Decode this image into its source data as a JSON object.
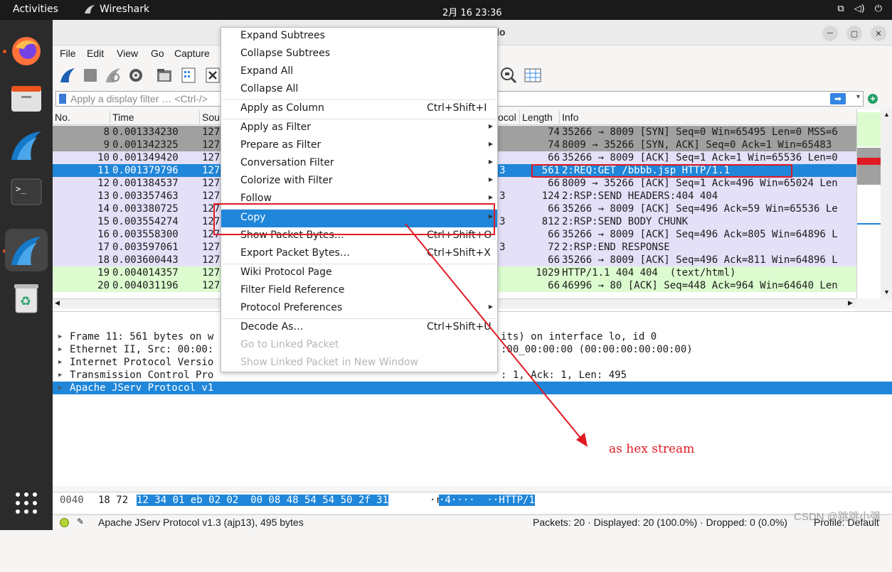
{
  "topbar": {
    "activities": "Activities",
    "app_name": "Wireshark",
    "clock": "2月 16  23:36"
  },
  "window": {
    "title_suffix": "lo",
    "menu": [
      "File",
      "Edit",
      "View",
      "Go",
      "Capture"
    ],
    "filter_placeholder": "Apply a display filter … <Ctrl-/>"
  },
  "packet_list": {
    "columns": [
      "No.",
      "Time",
      "Sou",
      "ocol",
      "Length",
      "Info"
    ],
    "rows": [
      {
        "no": "8",
        "time": "0.001334230",
        "src": "127",
        "proto": "",
        "len": "74",
        "info": "35266 → 8009 [SYN] Seq=0 Win=65495 Len=0 MSS=6",
        "style": "gray"
      },
      {
        "no": "9",
        "time": "0.001342325",
        "src": "127",
        "proto": "",
        "len": "74",
        "info": "8009 → 35266 [SYN, ACK] Seq=0 Ack=1 Win=65483",
        "style": "gray"
      },
      {
        "no": "10",
        "time": "0.001349420",
        "src": "127",
        "proto": "",
        "len": "66",
        "info": "35266 → 8009 [ACK] Seq=1 Ack=1 Win=65536 Len=0",
        "style": "lav"
      },
      {
        "no": "11",
        "time": "0.001379796",
        "src": "127",
        "proto": "3",
        "len": "561",
        "info": "2:REQ:GET /bbbb.jsp HTTP/1.1",
        "style": "sel"
      },
      {
        "no": "12",
        "time": "0.001384537",
        "src": "127",
        "proto": "",
        "len": "66",
        "info": "8009 → 35266 [ACK] Seq=1 Ack=496 Win=65024 Len",
        "style": "lav"
      },
      {
        "no": "13",
        "time": "0.003357463",
        "src": "127",
        "proto": "3",
        "len": "124",
        "info": "2:RSP:SEND HEADERS:404 404",
        "style": "lav"
      },
      {
        "no": "14",
        "time": "0.003380725",
        "src": "127",
        "proto": "",
        "len": "66",
        "info": "35266 → 8009 [ACK] Seq=496 Ack=59 Win=65536 Le",
        "style": "lav"
      },
      {
        "no": "15",
        "time": "0.003554274",
        "src": "127",
        "proto": "3",
        "len": "812",
        "info": "2:RSP:SEND BODY CHUNK",
        "style": "lav"
      },
      {
        "no": "16",
        "time": "0.003558300",
        "src": "127",
        "proto": "",
        "len": "66",
        "info": "35266 → 8009 [ACK] Seq=496 Ack=805 Win=64896 L",
        "style": "lav"
      },
      {
        "no": "17",
        "time": "0.003597061",
        "src": "127",
        "proto": "3",
        "len": "72",
        "info": "2:RSP:END RESPONSE",
        "style": "lav"
      },
      {
        "no": "18",
        "time": "0.003600443",
        "src": "127",
        "proto": "",
        "len": "66",
        "info": "35266 → 8009 [ACK] Seq=496 Ack=811 Win=64896 L",
        "style": "lav"
      },
      {
        "no": "19",
        "time": "0.004014357",
        "src": "127",
        "proto": "",
        "len": "1029",
        "info": "HTTP/1.1 404 404  (text/html)",
        "style": "green"
      },
      {
        "no": "20",
        "time": "0.004031196",
        "src": "127",
        "proto": "",
        "len": "66",
        "info": "46996 → 80 [ACK] Seq=448 Ack=964 Win=64640 Len",
        "style": "green"
      }
    ]
  },
  "details": {
    "rows": [
      {
        "left": "Frame 11: 561 bytes on w",
        "right": "its) on interface lo, id 0"
      },
      {
        "left": "Ethernet II, Src: 00:00:",
        "right": ":00_00:00:00 (00:00:00:00:00:00)"
      },
      {
        "left": "Internet Protocol Versio",
        "right": ""
      },
      {
        "left": "Transmission Control Pro",
        "right": ": 1, Ack: 1, Len: 495"
      },
      {
        "left": "Apache JServ Protocol v1",
        "right": ""
      }
    ]
  },
  "bytes": {
    "offset": "0040",
    "hex_plain": "18 72",
    "hex_hl": "12 34 01 eb 02 02  00 08 48 54 54 50 2f 31",
    "ascii_plain": "·r",
    "ascii_hl": "·4····  ··HTTP/1"
  },
  "status": {
    "protocol": "Apache JServ Protocol v1.3 (ajp13), 495 bytes",
    "packets": "Packets: 20 · Displayed: 20 (100.0%) · Dropped: 0 (0.0%)",
    "profile": "Profile: Default"
  },
  "context_menu": {
    "items": [
      {
        "label": "Expand Subtrees",
        "shortcut": "",
        "submenu": false,
        "disabled": false
      },
      {
        "label": "Collapse Subtrees",
        "shortcut": "",
        "submenu": false,
        "disabled": false
      },
      {
        "label": "Expand All",
        "shortcut": "",
        "submenu": false,
        "disabled": false
      },
      {
        "label": "Collapse All",
        "shortcut": "",
        "submenu": false,
        "disabled": false
      },
      {
        "label": "Apply as Column",
        "shortcut": "Ctrl+Shift+I",
        "submenu": false,
        "disabled": false
      },
      {
        "label": "Apply as Filter",
        "shortcut": "",
        "submenu": true,
        "disabled": false
      },
      {
        "label": "Prepare as Filter",
        "shortcut": "",
        "submenu": true,
        "disabled": false
      },
      {
        "label": "Conversation Filter",
        "shortcut": "",
        "submenu": true,
        "disabled": false
      },
      {
        "label": "Colorize with Filter",
        "shortcut": "",
        "submenu": true,
        "disabled": false
      },
      {
        "label": "Follow",
        "shortcut": "",
        "submenu": true,
        "disabled": false
      },
      {
        "label": "Copy",
        "shortcut": "",
        "submenu": true,
        "disabled": false
      },
      {
        "label": "Show Packet Bytes…",
        "shortcut": "Ctrl+Shift+O",
        "submenu": false,
        "disabled": false
      },
      {
        "label": "Export Packet Bytes…",
        "shortcut": "Ctrl+Shift+X",
        "submenu": false,
        "disabled": false
      },
      {
        "label": "Wiki Protocol Page",
        "shortcut": "",
        "submenu": false,
        "disabled": false
      },
      {
        "label": "Filter Field Reference",
        "shortcut": "",
        "submenu": false,
        "disabled": false
      },
      {
        "label": "Protocol Preferences",
        "shortcut": "",
        "submenu": true,
        "disabled": false
      },
      {
        "label": "Decode As…",
        "shortcut": "Ctrl+Shift+U",
        "submenu": false,
        "disabled": false
      },
      {
        "label": "Go to Linked Packet",
        "shortcut": "",
        "submenu": false,
        "disabled": true
      },
      {
        "label": "Show Linked Packet in New Window",
        "shortcut": "",
        "submenu": false,
        "disabled": true
      }
    ]
  },
  "annotation": {
    "text": "as hex stream",
    "watermark": "CSDN @跳跳小强"
  },
  "colors": {
    "accent": "#1f86d9",
    "annotation_red": "#e01b24",
    "row_gray": "#a0a0a0",
    "row_lavender": "#e4e0f8",
    "row_green": "#dcfccf"
  }
}
